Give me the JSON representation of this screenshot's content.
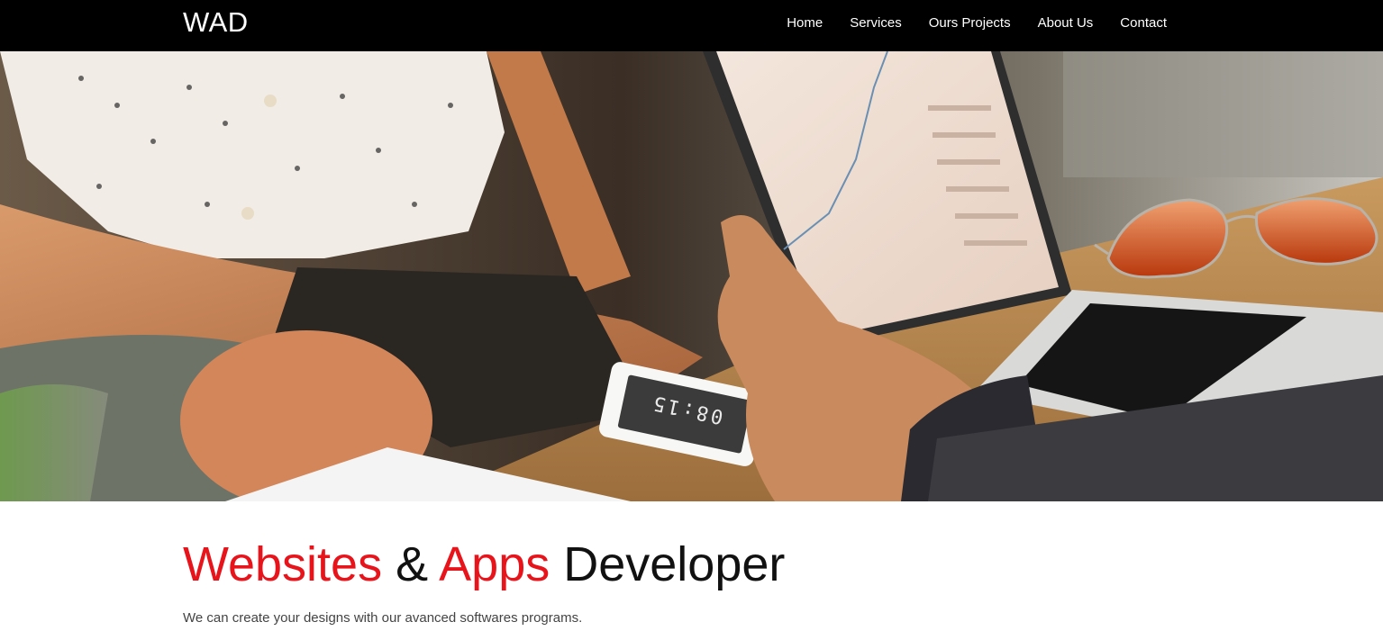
{
  "header": {
    "brand": "WAD",
    "nav": [
      {
        "label": "Home"
      },
      {
        "label": "Services"
      },
      {
        "label": "Ours Projects"
      },
      {
        "label": "About Us"
      },
      {
        "label": "Contact"
      }
    ]
  },
  "hero": {
    "phone_screen_text": "08:15"
  },
  "intro": {
    "headline_part1": "Websites",
    "headline_amp": " & ",
    "headline_part2": "Apps",
    "headline_part3": " Developer",
    "tagline": "We can create your designs with our avanced softwares programs."
  },
  "colors": {
    "navbar_bg": "#000000",
    "accent": "#e8141b",
    "text": "#111111"
  }
}
